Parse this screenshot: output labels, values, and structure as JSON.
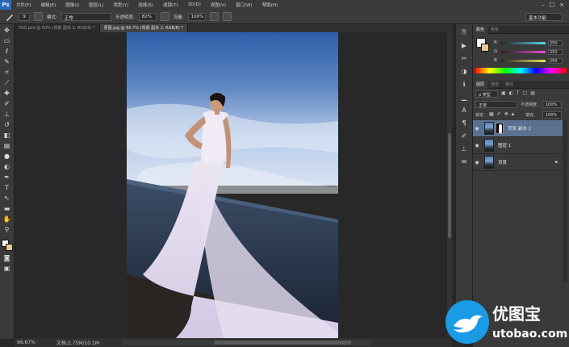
{
  "app": {
    "logo": "Ps"
  },
  "menu": [
    "文件(F)",
    "编辑(E)",
    "图像(I)",
    "图层(L)",
    "类型(Y)",
    "选择(S)",
    "滤镜(T)",
    "3D(D)",
    "视图(V)",
    "窗口(W)",
    "帮助(H)"
  ],
  "window_controls": [
    "–",
    "□",
    "×"
  ],
  "options": {
    "brush_size": "9",
    "mode_label": "模式:",
    "mode_value": "正常",
    "opacity_label": "不透明度:",
    "opacity_value": "82%",
    "flow_label": "流量:",
    "flow_value": "100%",
    "workspace": "基本功能"
  },
  "tabs": [
    {
      "label": "PSD.psd @ 50% (背景 副本 2, RGB/8) *",
      "active": false
    },
    {
      "label": "原图.jpg @ 66.7% (背景 副本 2, RGB/8) *",
      "active": true
    }
  ],
  "status": {
    "zoom": "66.67%",
    "doc": "文档:2.75M/10.1M"
  },
  "color_panel": {
    "tabs": [
      "颜色",
      "色板"
    ],
    "sliders": [
      {
        "label": "R",
        "value": "250",
        "color": "#56d6f0"
      },
      {
        "label": "G",
        "value": "250",
        "color": "#e94fd1"
      },
      {
        "label": "B",
        "value": "250",
        "color": "#f0e456"
      }
    ]
  },
  "layers_panel": {
    "tabs": [
      "图层",
      "通道",
      "路径"
    ],
    "filter_kind": "ρ 类型",
    "blend_mode": "正常",
    "opacity_label": "不透明度:",
    "opacity_value": "100%",
    "lock_label": "锁定:",
    "fill_label": "填充:",
    "fill_value": "100%",
    "layers": [
      {
        "name": "背景 副本 2",
        "selected": true,
        "has_mask": true,
        "locked": false
      },
      {
        "name": "图层 1",
        "selected": false,
        "has_mask": false,
        "locked": false
      },
      {
        "name": "背景",
        "selected": false,
        "has_mask": false,
        "locked": true
      }
    ]
  },
  "watermark": {
    "title": "优图宝",
    "url": "utobao.com"
  },
  "tools": [
    "move-tool-icon",
    "marquee-tool-icon",
    "lasso-tool-icon",
    "quick-select-icon",
    "crop-tool-icon",
    "eyedropper-icon",
    "healing-brush-icon",
    "brush-tool-icon",
    "clone-stamp-icon",
    "history-brush-icon",
    "eraser-icon",
    "gradient-icon",
    "blur-icon",
    "dodge-icon",
    "pen-tool-icon",
    "type-tool-icon",
    "path-select-icon",
    "shape-tool-icon",
    "hand-tool-icon",
    "zoom-tool-icon"
  ]
}
